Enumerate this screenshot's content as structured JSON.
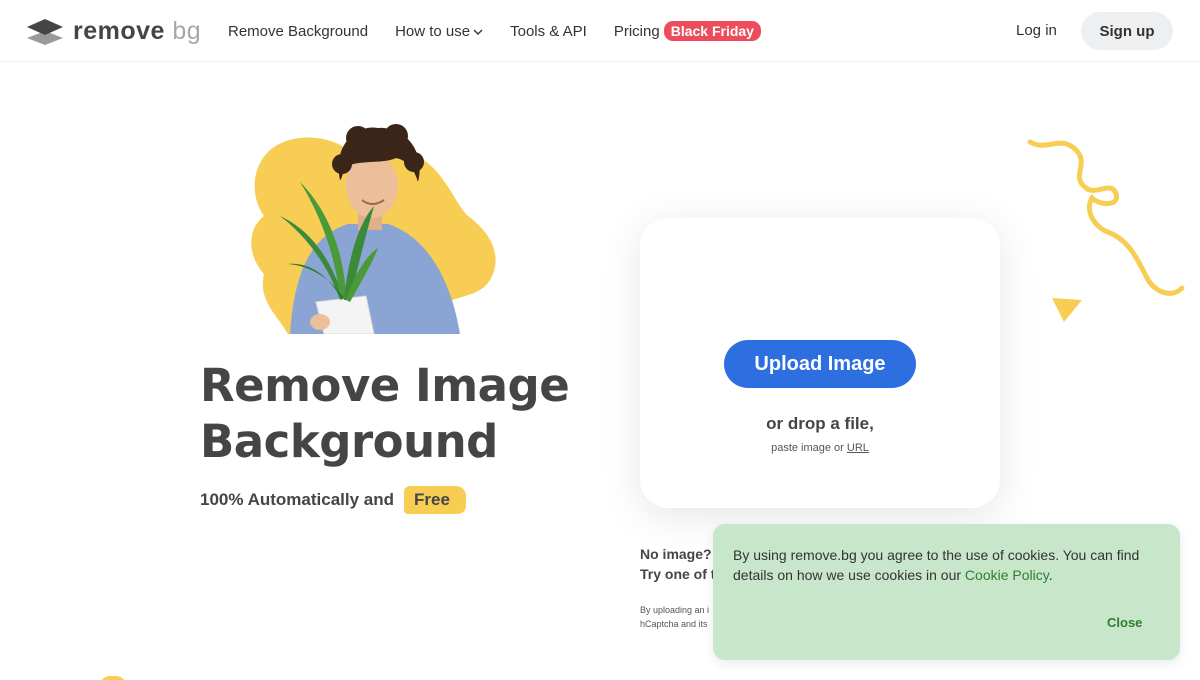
{
  "header": {
    "logo": {
      "remove": "remove",
      "bg": "bg"
    },
    "nav": [
      {
        "label": "Remove Background"
      },
      {
        "label": "How to use"
      },
      {
        "label": "Tools & API"
      },
      {
        "label": "Pricing"
      }
    ],
    "badge": "Black Friday",
    "login": "Log in",
    "signup": "Sign up"
  },
  "hero": {
    "title_line1": "Remove Image",
    "title_line2": "Background",
    "sub": "100% Automatically and",
    "free": "Free"
  },
  "upload": {
    "button": "Upload Image",
    "drop": "or drop a file,",
    "paste_prefix": "paste image or",
    "url": "URL"
  },
  "samples": {
    "line1": "No image?",
    "line2": "Try one of t"
  },
  "legal": {
    "line1": "By uploading an i",
    "line2": "hCaptcha and its"
  },
  "cookie": {
    "text": "By using remove.bg you agree to the use of cookies. You can find details on how we use cookies in our",
    "link": "Cookie Policy",
    "after": ".",
    "close": "Close"
  },
  "colors": {
    "accent_blue": "#2e6fe0",
    "badge_red": "#ec4c5b",
    "yellow": "#f7cd54",
    "cookie_bg": "#c8e6c9"
  }
}
